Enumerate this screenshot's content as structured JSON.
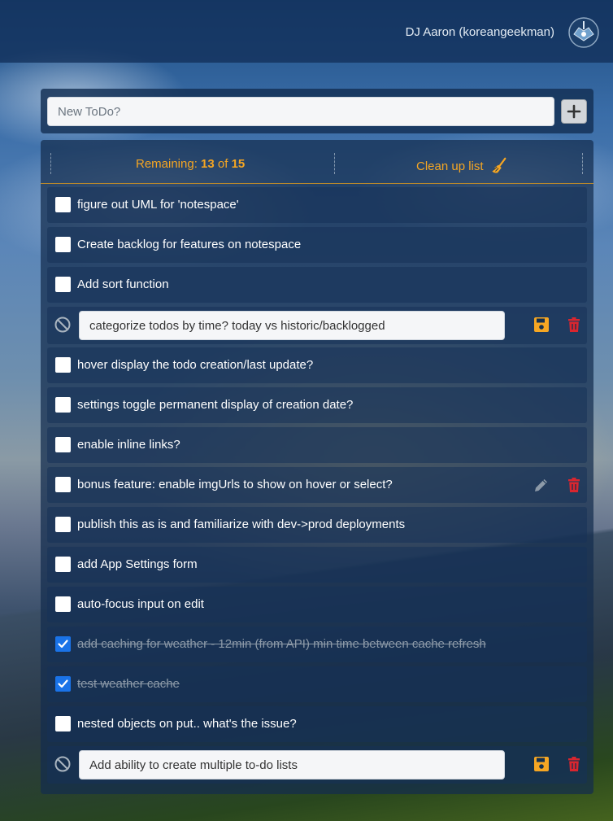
{
  "user": {
    "name": "DJ Aaron (koreangeekman)"
  },
  "new_todo": {
    "placeholder": "New ToDo?",
    "value": ""
  },
  "header": {
    "remaining_label": "Remaining:",
    "remaining_count": "13",
    "of_label": "of",
    "total_count": "15",
    "cleanup_label": "Clean up list"
  },
  "colors": {
    "accent": "#f5a623",
    "checked": "#1a73e8",
    "delete": "#d9262f"
  },
  "todos": [
    {
      "text": "figure out UML for 'notespace'",
      "done": false
    },
    {
      "text": "Create backlog for features on notespace",
      "done": false
    },
    {
      "text": "Add sort function",
      "done": false
    },
    {
      "text": "categorize todos by time? today vs historic/backlogged",
      "editing": true
    },
    {
      "text": "hover display the todo creation/last update?",
      "done": false
    },
    {
      "text": "settings toggle permanent display of creation date?",
      "done": false
    },
    {
      "text": "enable inline links?",
      "done": false
    },
    {
      "text": "bonus feature: enable imgUrls to show on hover or select?",
      "done": false,
      "hovered": true
    },
    {
      "text": "publish this as is and familiarize with dev->prod deployments",
      "done": false
    },
    {
      "text": "add App Settings form",
      "done": false
    },
    {
      "text": "auto-focus input on edit",
      "done": false
    },
    {
      "text": "add caching for weather - 12min (from API) min time between cache refresh",
      "done": true
    },
    {
      "text": "test weather cache",
      "done": true
    },
    {
      "text": "nested objects on put.. what's the issue?",
      "done": false
    },
    {
      "text": "Add ability to create multiple to-do lists",
      "editing": true
    }
  ]
}
